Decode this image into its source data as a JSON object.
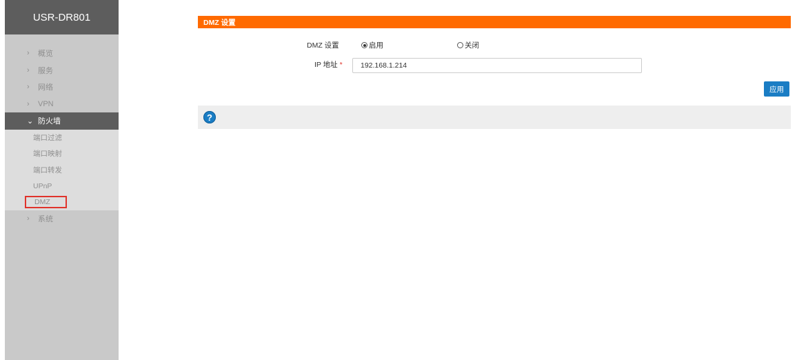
{
  "app": {
    "title": "USR-DR801"
  },
  "sidebar": {
    "items": [
      {
        "label": "概览",
        "icon": "chevron-right-icon"
      },
      {
        "label": "服务",
        "icon": "chevron-right-icon"
      },
      {
        "label": "网络",
        "icon": "chevron-right-icon"
      },
      {
        "label": "VPN",
        "icon": "chevron-right-icon"
      },
      {
        "label": "防火墙",
        "icon": "chevron-down-icon",
        "expanded": true
      },
      {
        "label": "系统",
        "icon": "chevron-right-icon"
      }
    ],
    "firewall_sub": [
      {
        "label": "端口过滤"
      },
      {
        "label": "端口映射"
      },
      {
        "label": "端口转发"
      },
      {
        "label": "UPnP"
      },
      {
        "label": "DMZ",
        "selected": true
      }
    ]
  },
  "section": {
    "title": "DMZ 设置"
  },
  "form": {
    "dmz_label": "DMZ 设置",
    "enable_label": "启用",
    "disable_label": "关闭",
    "dmz_value": "启用",
    "ip_label": "IP 地址",
    "ip_required_mark": "*",
    "ip_value": "192.168.1.214"
  },
  "actions": {
    "apply_label": "应用"
  },
  "help": {
    "icon": "help-icon",
    "glyph": "?"
  },
  "colors": {
    "accent": "#ff6a00",
    "primary": "#1a7dc4",
    "sidebar_bg": "#c9c9c9",
    "sidebar_dark": "#5d5d5d",
    "selected_outline": "#e0332b"
  }
}
